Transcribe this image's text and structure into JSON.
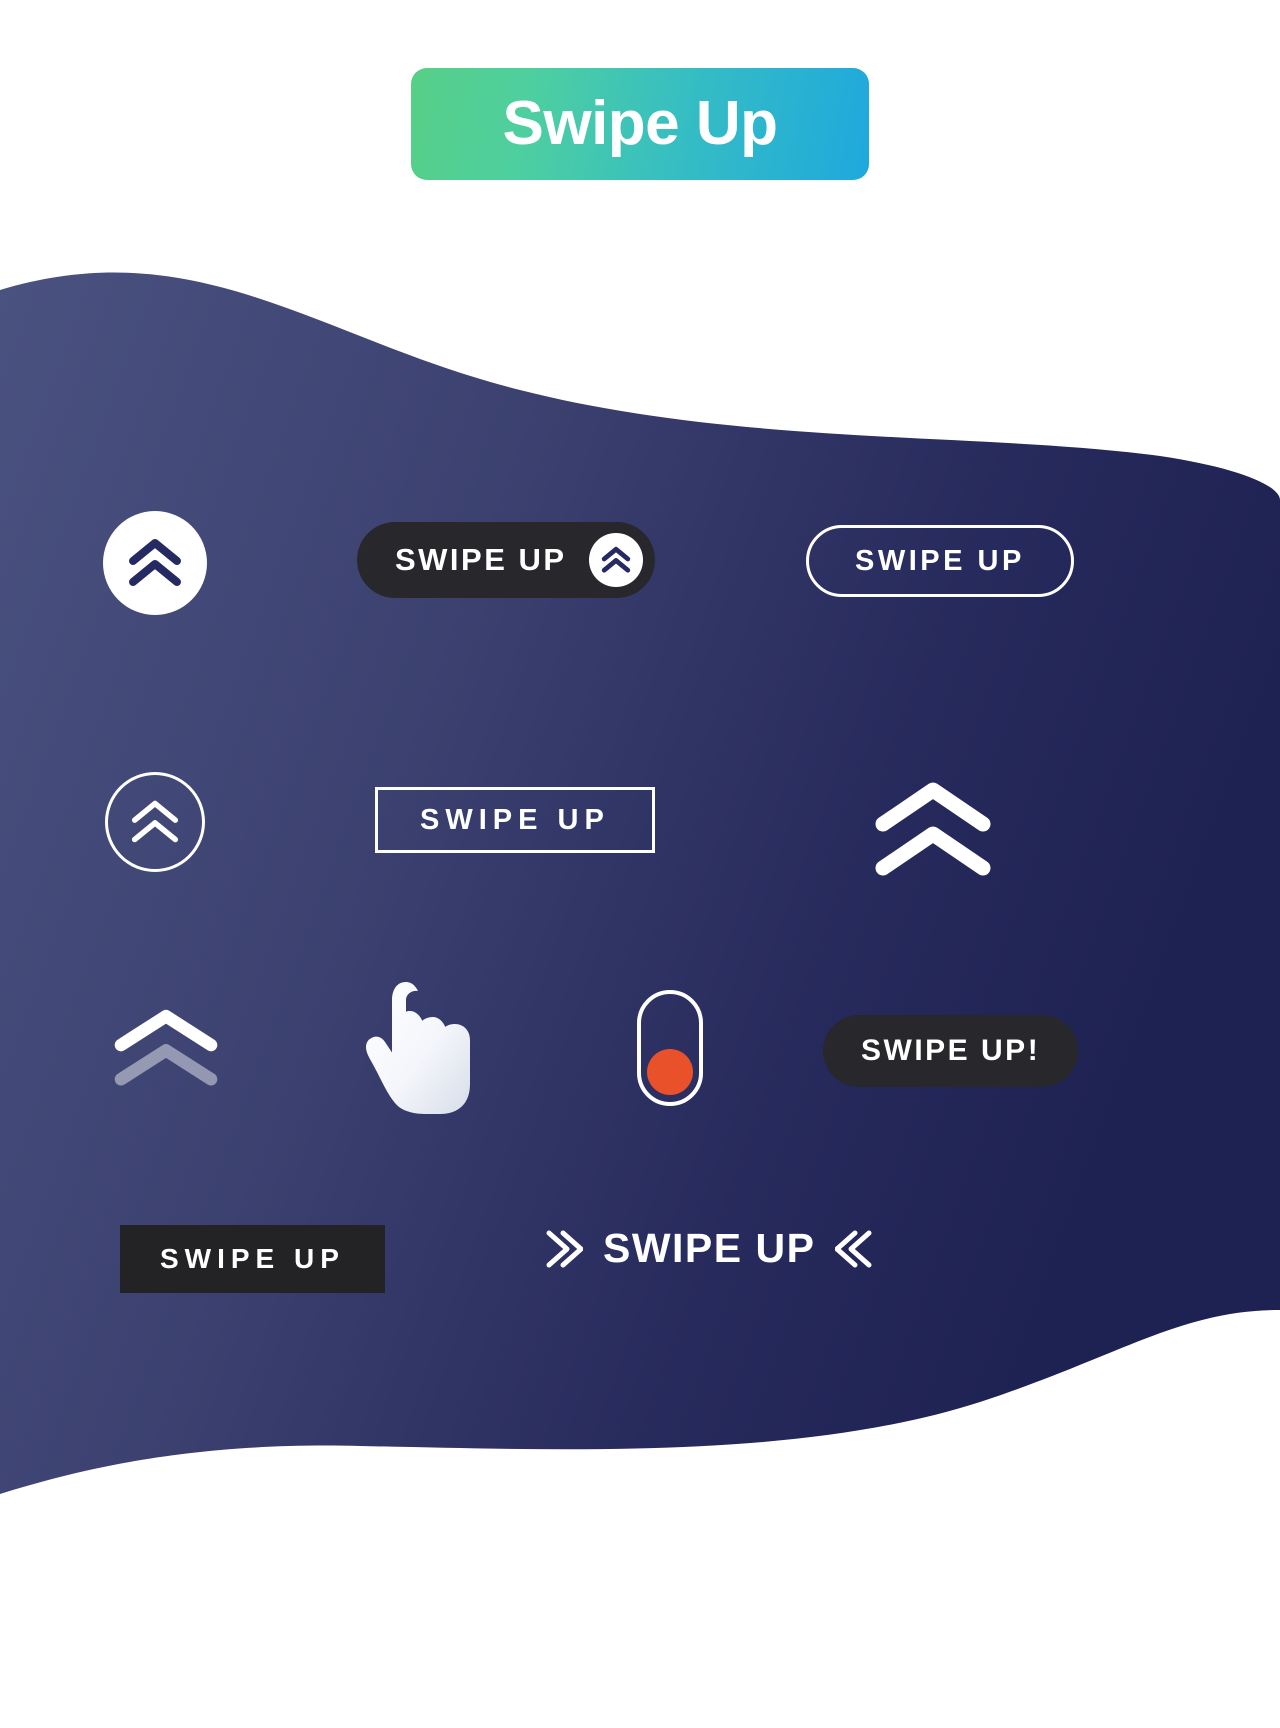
{
  "header": {
    "badge_label": "Swipe Up",
    "gradient_from": "#57cf86",
    "gradient_to": "#1fa8dd",
    "text_color": "#ffffff"
  },
  "canvas": {
    "background": "#ffffff",
    "blob_gradient_from": "#4a5280",
    "blob_gradient_to": "#1e2252",
    "accent_orange": "#e8512a",
    "dark_chip": "#27272c",
    "white": "#ffffff"
  },
  "elements": [
    {
      "id": "circle-solid-chevron",
      "type": "icon-button",
      "style": "white-circle-navy-chevron",
      "label": "",
      "icon": "double-chevron-up-icon"
    },
    {
      "id": "pill-dark-chevron",
      "type": "pill-button",
      "style": "dark-filled",
      "label": "SWIPE UP",
      "icon": "double-chevron-up-icon"
    },
    {
      "id": "pill-outline",
      "type": "pill-button",
      "style": "white-outline",
      "label": "SWIPE UP",
      "icon": ""
    },
    {
      "id": "circle-outline-chevron",
      "type": "icon-button",
      "style": "white-outline-circle",
      "label": "",
      "icon": "double-chevron-up-icon"
    },
    {
      "id": "rect-outline",
      "type": "rect-button",
      "style": "white-outline",
      "label": "SWIPE UP",
      "icon": ""
    },
    {
      "id": "chevron-bold-large",
      "type": "icon",
      "style": "white-bold-chevron",
      "label": "",
      "icon": "double-chevron-up-icon"
    },
    {
      "id": "chevron-fade",
      "type": "icon",
      "style": "white-fading-chevron",
      "label": "",
      "icon": "double-chevron-up-icon"
    },
    {
      "id": "hand-cursor",
      "type": "icon",
      "style": "white-gradient-hand",
      "label": "",
      "icon": "pointing-hand-icon"
    },
    {
      "id": "toggle-orange",
      "type": "toggle",
      "style": "outline-capsule-orange-dot",
      "label": "",
      "icon": "toggle-switch-icon"
    },
    {
      "id": "pill-dark-exclaim",
      "type": "pill-button",
      "style": "dark-filled",
      "label": "SWIPE UP!",
      "icon": ""
    },
    {
      "id": "rect-dark",
      "type": "rect-button",
      "style": "dark-filled",
      "label": "SWIPE UP",
      "icon": ""
    },
    {
      "id": "chevron-bracket-text",
      "type": "label",
      "style": "white-text-with-side-chevrons",
      "label": "SWIPE UP",
      "icon": "chevron-right-icon, chevron-left-icon"
    }
  ]
}
